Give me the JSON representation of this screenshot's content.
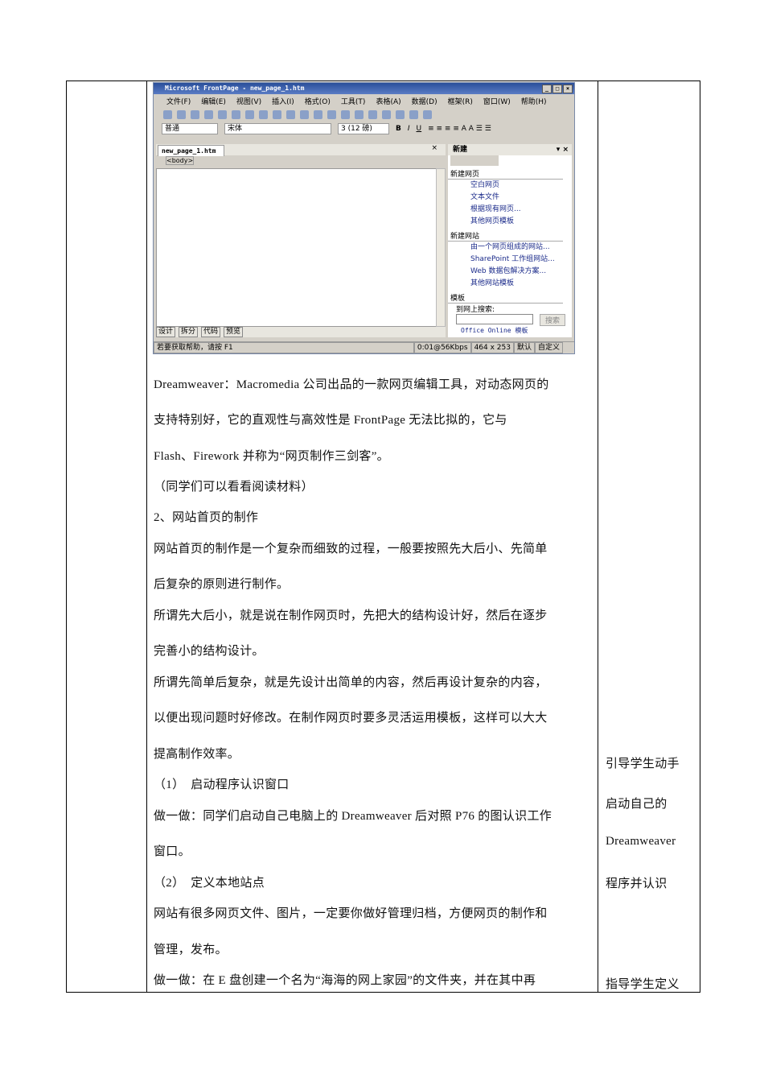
{
  "screenshot": {
    "title": "Microsoft FrontPage - new_page_1.htm",
    "menu": [
      "文件(F)",
      "编辑(E)",
      "视图(V)",
      "插入(I)",
      "格式(O)",
      "工具(T)",
      "表格(A)",
      "数据(D)",
      "框架(R)",
      "窗口(W)",
      "帮助(H)"
    ],
    "style_select": "普通",
    "font_select": "宋体",
    "size_select": "3 (12 磅)",
    "format_buttons": [
      "B",
      "I",
      "U"
    ],
    "doc_tab": "new_page_1.htm",
    "tag": "<body>",
    "view_tabs": [
      "设计",
      "拆分",
      "代码",
      "预览"
    ],
    "pane": {
      "title": "新建",
      "sections": [
        {
          "heading": "新建网页",
          "items": [
            "空白网页",
            "文本文件",
            "根据现有网页...",
            "其他网页模板"
          ]
        },
        {
          "heading": "新建网站",
          "items": [
            "由一个网页组成的网站...",
            "SharePoint 工作组网站...",
            "Web 数据包解决方案...",
            "其他网站模板"
          ]
        },
        {
          "heading": "模板",
          "items": [
            "到网上搜索:"
          ]
        }
      ],
      "search_button": "搜索",
      "office_link": "Office Online 模板"
    },
    "status": {
      "help": "若要获取帮助，请按 F1",
      "speed": "0:01@56Kbps",
      "size": "464 x 253",
      "mode1": "默认",
      "mode2": "自定义"
    }
  },
  "lines": [
    "Dreamweaver：Macromedia 公司出品的一款网页编辑工具，对动态网页的",
    "支持特别好，它的直观性与高效性是 FrontPage 无法比拟的，它与",
    "Flash、Firework 并称为“网页制作三剑客”。",
    "（同学们可以看看阅读材料）",
    "2、网站首页的制作",
    "网站首页的制作是一个复杂而细致的过程，一般要按照先大后小、先简单",
    "后复杂的原则进行制作。",
    "所谓先大后小，就是说在制作网页时，先把大的结构设计好，然后在逐步",
    "完善小的结构设计。",
    "所谓先简单后复杂，就是先设计出简单的内容，然后再设计复杂的内容，",
    "以便出现问题时好修改。在制作网页时要多灵活运用模板，这样可以大大",
    "提高制作效率。",
    "（1）　启动程序认识窗口",
    "做一做：同学们启动自己电脑上的 Dreamweaver 后对照 P76 的图认识工作",
    "窗口。",
    "（2）　定义本地站点",
    "网站有很多网页文件、图片，一定要你做好管理归档，方便网页的制作和",
    "管理，发布。",
    "做一做：在 E 盘创建一个名为“海海的网上家园”的文件夹，并在其中再"
  ],
  "right_lines": [
    "引导学生动手",
    "启动自己的",
    "Dreamweaver",
    "程序并认识",
    "指导学生定义"
  ]
}
